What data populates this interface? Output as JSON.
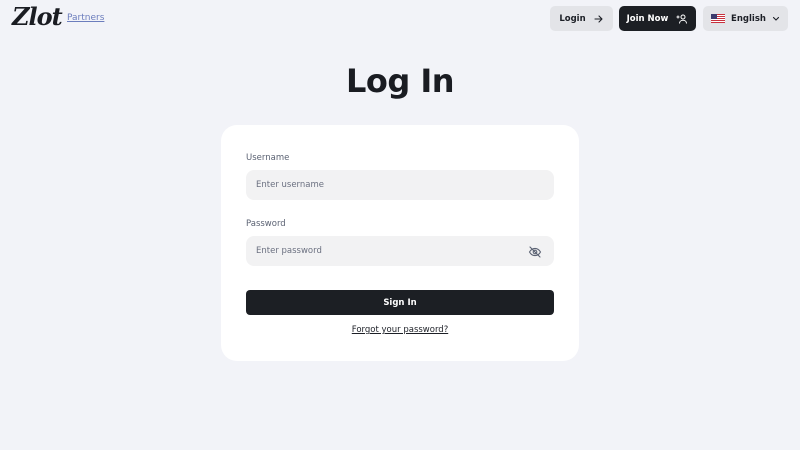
{
  "header": {
    "logo_text": "Zlot",
    "partners_label": "Partners",
    "login_label": "Login",
    "join_label": "Join Now",
    "language_label": "English",
    "login_icon": "arrow-right-icon",
    "join_icon": "add-user-icon",
    "language_flag": "us-flag-icon",
    "language_chevron": "chevron-down-icon"
  },
  "main": {
    "title": "Log In"
  },
  "form": {
    "username_label": "Username",
    "username_placeholder": "Enter username",
    "username_value": "",
    "password_label": "Password",
    "password_placeholder": "Enter password",
    "password_value": "",
    "password_toggle_icon": "eye-off-icon",
    "submit_label": "Sign In",
    "forgot_label": "Forgot your password?"
  },
  "colors": {
    "background": "#f2f3f8",
    "card": "#ffffff",
    "primary_dark": "#1c1f24",
    "secondary_button": "#e3e4e8",
    "link": "#6c7dbd"
  }
}
